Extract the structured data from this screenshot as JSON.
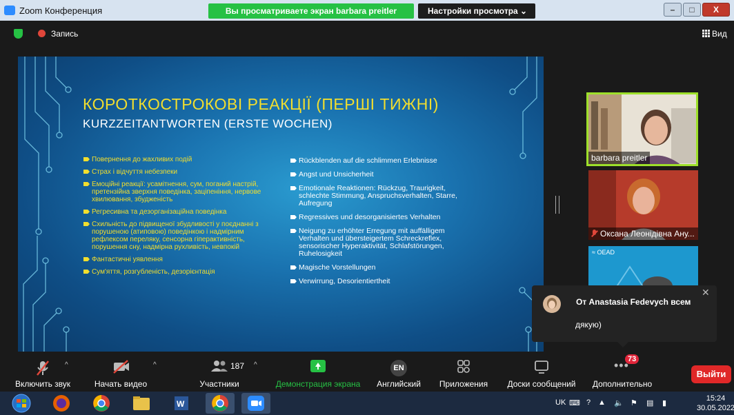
{
  "window": {
    "title": "Zoom Конференция",
    "share_banner": "Вы просматриваете экран barbara preitler",
    "view_settings": "Настройки просмотра ⌄"
  },
  "topbar": {
    "record_label": "Запись",
    "view_label": "Вид"
  },
  "slide": {
    "title": "КОРОТКОСТРОКОВІ РЕАКЦІЇ (ПЕРШІ ТИЖНІ)",
    "subtitle": "KURZZEITANTWORTEN (ERSTE WOCHEN)",
    "left_items": [
      "Повернення до жахливих подій",
      "Страх і відчуття небезпеки",
      "Емоційні реакції: усамітнення, сум, поганий настрій, претензійна зверхня поведінка, заціпеніння, нервове хвилювання, збудженість",
      "Регресивна та дезорганізаційна поведінка",
      "Схильність до підвищеної збудливості у поєднанні з порушеною (атиповою) поведінкою і надмірним рефлексом переляку, сенсорна гіперактивність, порушення сну, надмірна рухливість, невпокій",
      "Фантастичні уявлення",
      "Сум'яття, розгубленість, дезорієнтація"
    ],
    "right_items": [
      "Rückblenden auf die schlimmen Erlebnisse",
      "Angst und Unsicherheit",
      "Emotionale Reaktionen: Rückzug, Traurigkeit, schlechte Stimmung, Anspruchsverhalten, Starre, Aufregung",
      "Regressives und desorganisiertes Verhalten",
      "Neigung zu erhöhter Erregung mit auffälligem Verhalten und übersteigertem Schreckreflex, sensorischer Hyperaktivität, Schlafstörungen, Ruhelosigkeit",
      "Magische Vorstellungen",
      "Verwirrung, Desorientiertheit"
    ]
  },
  "participants": [
    {
      "name": "barbara preitler"
    },
    {
      "name": "Оксана Леонідівна Ану..."
    },
    {
      "name": "≈ OEAD"
    }
  ],
  "chat_toast": {
    "from": "От Anastasia Fedevych всем",
    "message": "дякую)"
  },
  "toolbar": {
    "unmute": "Включить звук",
    "start_video": "Начать видео",
    "participants": "Участники",
    "participants_count": "187",
    "share": "Демонстрация экрана",
    "language": "Английский",
    "language_code": "EN",
    "apps": "Приложения",
    "whiteboards": "Доски сообщений",
    "more": "Дополнительно",
    "more_badge": "73",
    "leave": "Выйти"
  },
  "taskbar": {
    "lang": "UK",
    "time": "15:24",
    "date": "30.05.2022",
    "apps": [
      "start-orb-icon",
      "firefox-icon",
      "chrome-icon",
      "explorer-folder-icon",
      "word-icon",
      "chrome-active-icon",
      "zoom-icon"
    ]
  },
  "colors": {
    "share_green": "#26c144",
    "slide_title_yellow": "#f2de2e",
    "leave_red": "#e02828",
    "active_speaker": "#9ee02a"
  }
}
